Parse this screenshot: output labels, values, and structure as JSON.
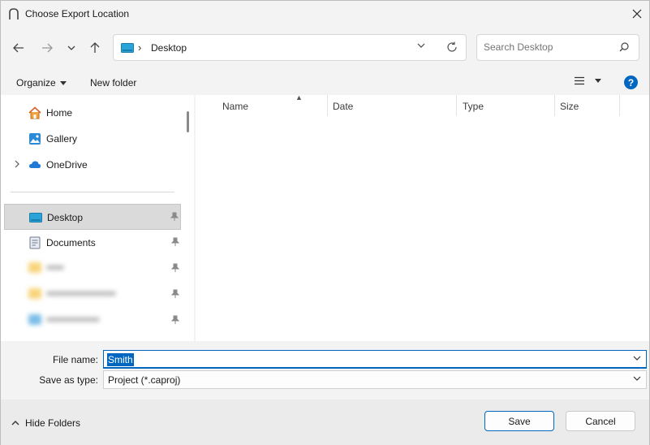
{
  "window": {
    "title": "Choose Export Location"
  },
  "nav": {
    "breadcrumb": "Desktop",
    "search_placeholder": "Search Desktop"
  },
  "toolbar": {
    "organize": "Organize",
    "new_folder": "New folder",
    "help": "?"
  },
  "sidebar": {
    "quick": [
      {
        "label": "Home",
        "icon": "home-icon"
      },
      {
        "label": "Gallery",
        "icon": "gallery-icon"
      },
      {
        "label": "OneDrive",
        "icon": "onedrive-icon"
      }
    ],
    "pinned": [
      {
        "label": "Desktop",
        "icon": "desktop-icon",
        "selected": true
      },
      {
        "label": "Documents",
        "icon": "documents-icon"
      }
    ]
  },
  "filelist": {
    "columns": [
      "Name",
      "Date",
      "Type",
      "Size"
    ]
  },
  "form": {
    "filename_label": "File name:",
    "filename_value": "Smith",
    "savetype_label": "Save as type:",
    "savetype_value": "Project (*.caproj)"
  },
  "footer": {
    "hide_folders": "Hide Folders",
    "save": "Save",
    "cancel": "Cancel"
  },
  "colors": {
    "accent": "#0067c0",
    "selected_bg": "#dadada"
  }
}
